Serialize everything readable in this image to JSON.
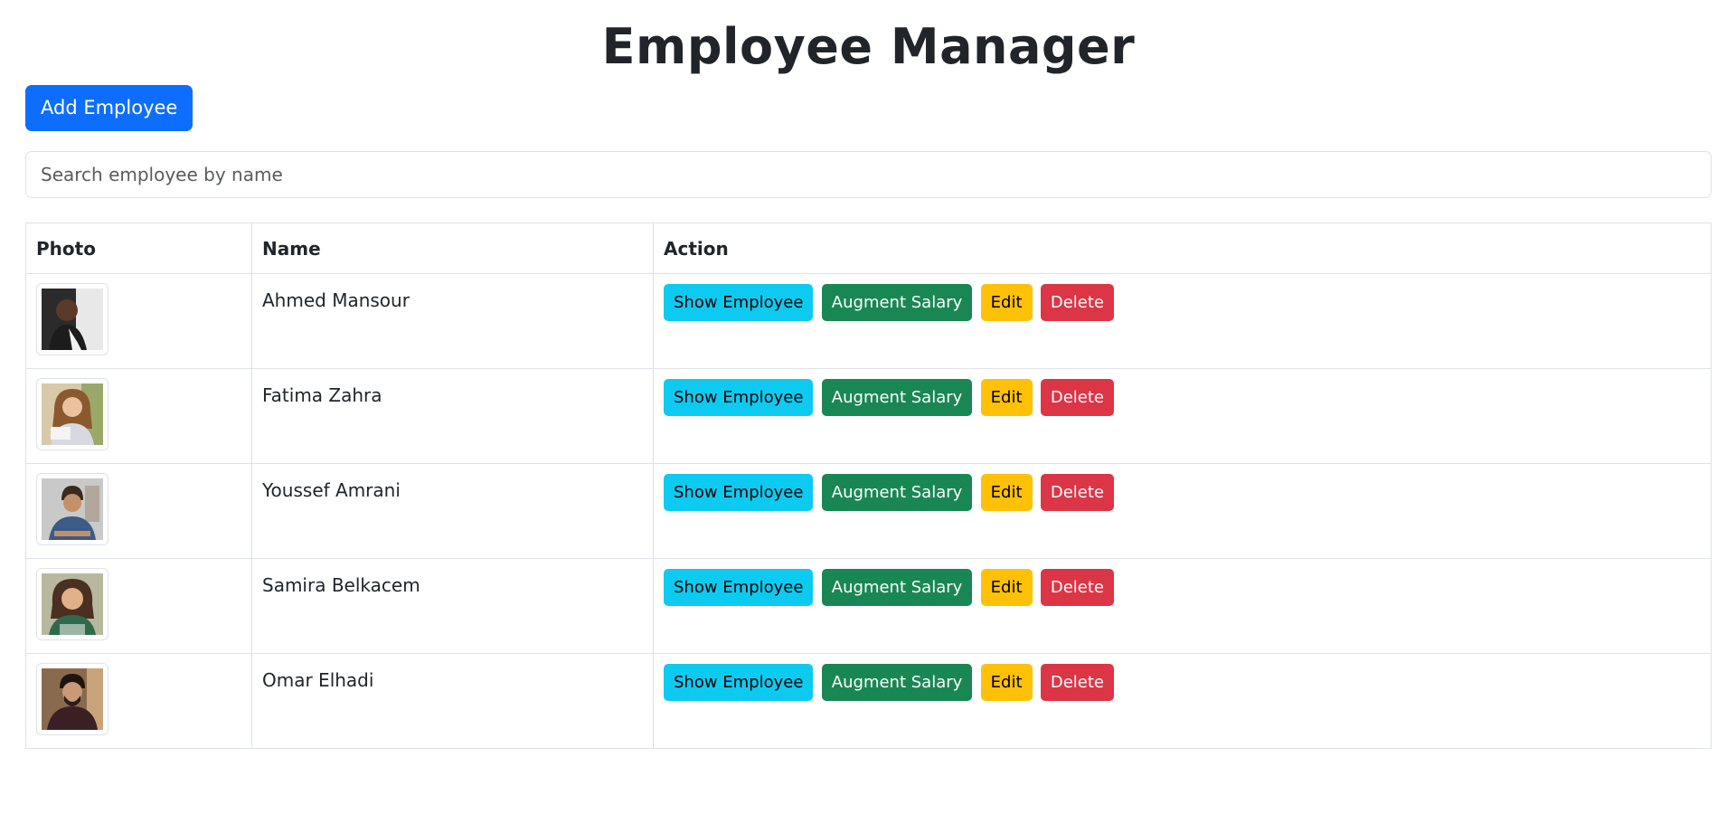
{
  "page_title": "Employee Manager",
  "add_button_label": "Add Employee",
  "search": {
    "placeholder": "Search employee by name",
    "value": ""
  },
  "table": {
    "headers": [
      "Photo",
      "Name",
      "Action"
    ],
    "actions": {
      "show": "Show Employee",
      "augment": "Augment Salary",
      "edit": "Edit",
      "delete": "Delete"
    },
    "rows": [
      {
        "name": "Ahmed Mansour"
      },
      {
        "name": "Fatima Zahra"
      },
      {
        "name": "Youssef Amrani"
      },
      {
        "name": "Samira Belkacem"
      },
      {
        "name": "Omar Elhadi"
      }
    ]
  },
  "colors": {
    "primary": "#0d6efd",
    "info": "#0dcaf0",
    "success": "#198754",
    "warning": "#ffc107",
    "danger": "#dc3545"
  }
}
